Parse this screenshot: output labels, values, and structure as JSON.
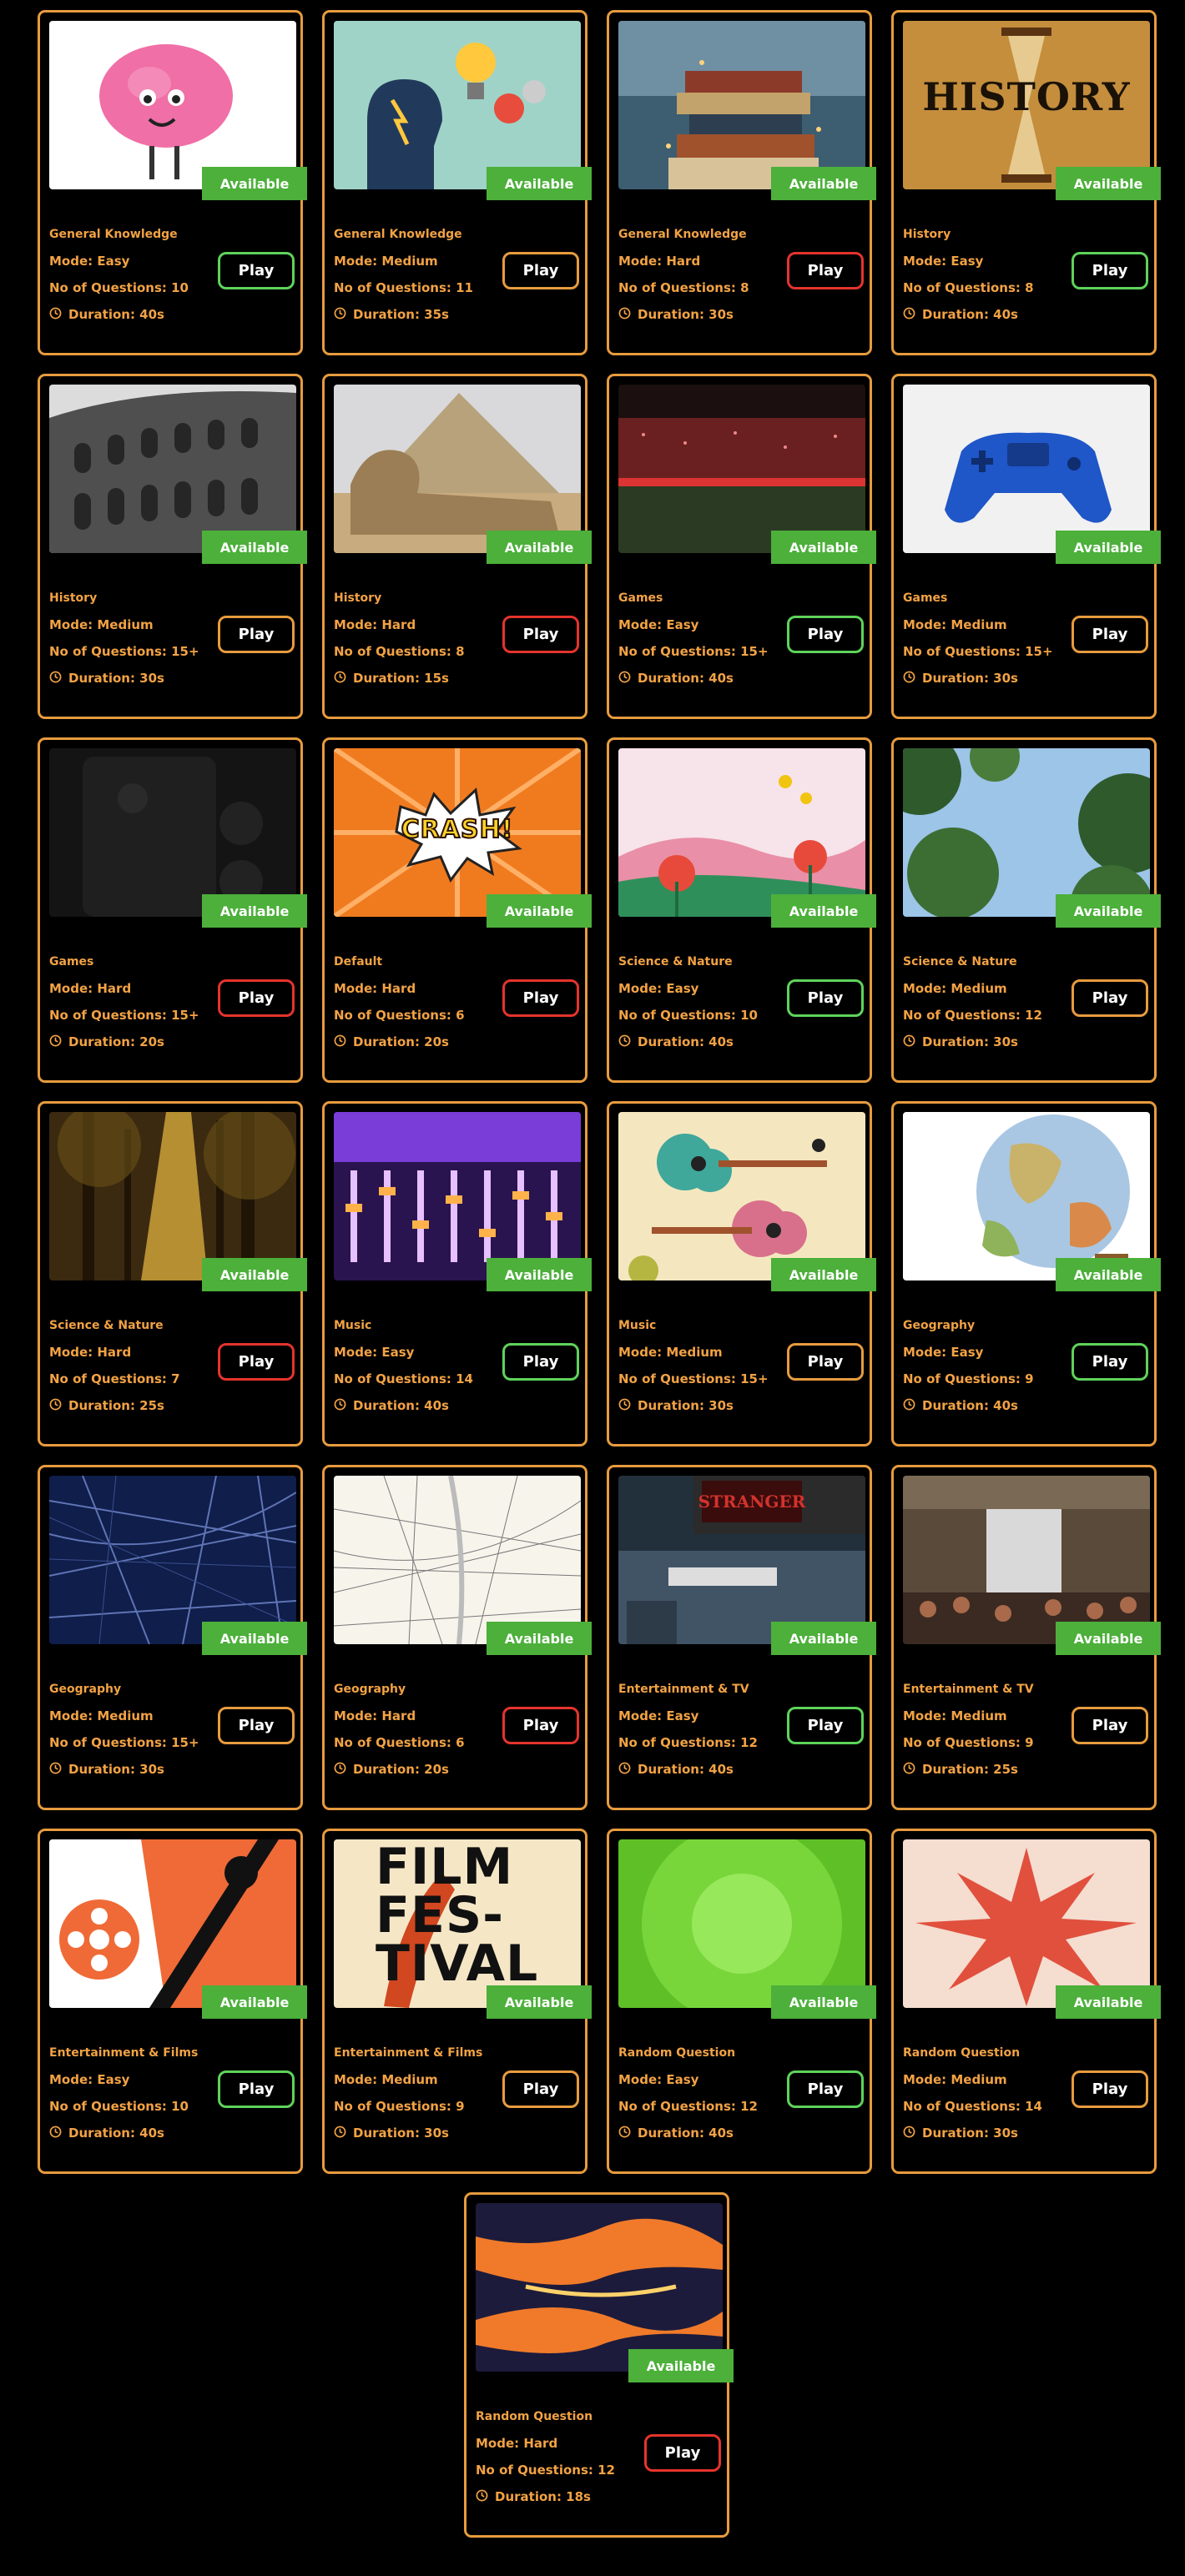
{
  "labels": {
    "available": "Available",
    "play": "Play",
    "mode_prefix": "Mode: ",
    "questions_prefix": "No of Questions: ",
    "duration_prefix": "Duration: "
  },
  "colors": {
    "border": "#e79b3e",
    "badge": "#4cb03a",
    "text": "#f2a244",
    "easy": "#5ed35a",
    "hard": "#e5342c"
  },
  "cards": [
    {
      "category": "General Knowledge",
      "mode": "Easy",
      "questions": "10",
      "duration": "40s",
      "image": "cartoon-brain"
    },
    {
      "category": "General Knowledge",
      "mode": "Medium",
      "questions": "11",
      "duration": "35s",
      "image": "head-lightbulb"
    },
    {
      "category": "General Knowledge",
      "mode": "Hard",
      "questions": "8",
      "duration": "30s",
      "image": "book-stack"
    },
    {
      "category": "History",
      "mode": "Easy",
      "questions": "8",
      "duration": "40s",
      "image": "hourglass-history",
      "image_text": "HISTORY"
    },
    {
      "category": "History",
      "mode": "Medium",
      "questions": "15+",
      "duration": "30s",
      "image": "colosseum"
    },
    {
      "category": "History",
      "mode": "Hard",
      "questions": "8",
      "duration": "15s",
      "image": "sphinx-pyramid"
    },
    {
      "category": "Games",
      "mode": "Easy",
      "questions": "15+",
      "duration": "40s",
      "image": "stadium"
    },
    {
      "category": "Games",
      "mode": "Medium",
      "questions": "15+",
      "duration": "30s",
      "image": "blue-gamepad"
    },
    {
      "category": "Games",
      "mode": "Hard",
      "questions": "15+",
      "duration": "20s",
      "image": "dark-controller"
    },
    {
      "category": "Default",
      "mode": "Hard",
      "questions": "6",
      "duration": "20s",
      "image": "comic-crash",
      "image_text": "CRASH!"
    },
    {
      "category": "Science & Nature",
      "mode": "Easy",
      "questions": "10",
      "duration": "40s",
      "image": "flowers-illustration"
    },
    {
      "category": "Science & Nature",
      "mode": "Medium",
      "questions": "12",
      "duration": "30s",
      "image": "tree-canopy"
    },
    {
      "category": "Science & Nature",
      "mode": "Hard",
      "questions": "7",
      "duration": "25s",
      "image": "forest-sunlight"
    },
    {
      "category": "Music",
      "mode": "Easy",
      "questions": "14",
      "duration": "40s",
      "image": "mixing-console"
    },
    {
      "category": "Music",
      "mode": "Medium",
      "questions": "15+",
      "duration": "30s",
      "image": "guitars-illustration"
    },
    {
      "category": "Geography",
      "mode": "Easy",
      "questions": "9",
      "duration": "40s",
      "image": "globe"
    },
    {
      "category": "Geography",
      "mode": "Medium",
      "questions": "15+",
      "duration": "30s",
      "image": "navy-street-map"
    },
    {
      "category": "Geography",
      "mode": "Hard",
      "questions": "6",
      "duration": "20s",
      "image": "line-street-map"
    },
    {
      "category": "Entertainment & TV",
      "mode": "Easy",
      "questions": "12",
      "duration": "40s",
      "image": "stranger-things-street"
    },
    {
      "category": "Entertainment & TV",
      "mode": "Medium",
      "questions": "9",
      "duration": "25s",
      "image": "terminal-crowd"
    },
    {
      "category": "Entertainment & Films",
      "mode": "Easy",
      "questions": "10",
      "duration": "40s",
      "image": "film-reel"
    },
    {
      "category": "Entertainment & Films",
      "mode": "Medium",
      "questions": "9",
      "duration": "30s",
      "image": "film-festival-poster",
      "image_text": "FILM FES- TIVAL"
    },
    {
      "category": "Random Question",
      "mode": "Easy",
      "questions": "12",
      "duration": "40s",
      "image": "green-burst"
    },
    {
      "category": "Random Question",
      "mode": "Medium",
      "questions": "14",
      "duration": "30s",
      "image": "red-starburst"
    },
    {
      "category": "Random Question",
      "mode": "Hard",
      "questions": "12",
      "duration": "18s",
      "image": "dark-swirl"
    }
  ]
}
